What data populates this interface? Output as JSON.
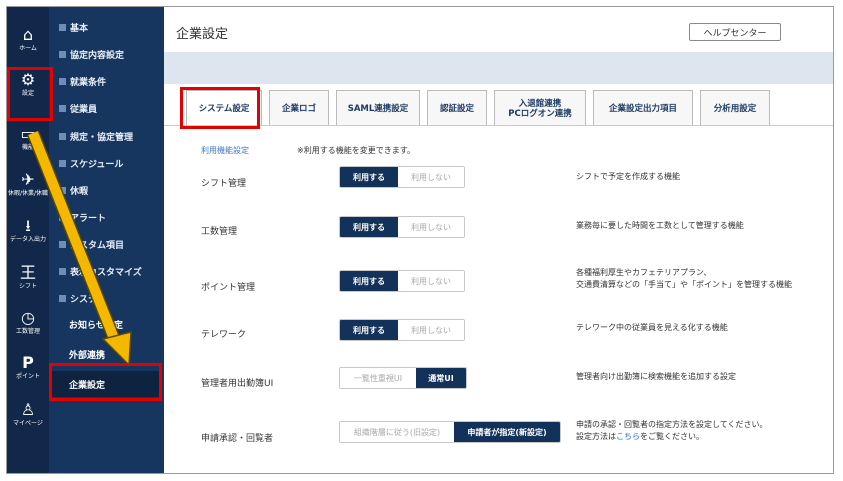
{
  "rail": [
    {
      "icon": "home-icon",
      "glyph": "⌂",
      "label": "ホーム"
    },
    {
      "icon": "gear-icon",
      "glyph": "⚙",
      "label": "設定"
    },
    {
      "icon": "function-icon",
      "glyph": "▭",
      "label": "機能"
    },
    {
      "icon": "plane-icon",
      "glyph": "✈",
      "label": "休暇/休業/休職"
    },
    {
      "icon": "download-icon",
      "glyph": "⭳",
      "label": "データ入出力"
    },
    {
      "icon": "shift-icon",
      "glyph": "王",
      "label": "シフト"
    },
    {
      "icon": "clock-icon",
      "glyph": "◷",
      "label": "工数管理"
    },
    {
      "icon": "point-icon",
      "glyph": "P",
      "label": "ポイント"
    },
    {
      "icon": "user-icon",
      "glyph": "♙",
      "label": "マイページ"
    }
  ],
  "menu": {
    "items": [
      {
        "label": "基本"
      },
      {
        "label": "協定内容設定"
      },
      {
        "label": "就業条件"
      },
      {
        "label": "従業員"
      },
      {
        "label": "規定・協定管理"
      },
      {
        "label": "スケジュール"
      },
      {
        "label": "休暇"
      },
      {
        "label": "アラート"
      },
      {
        "label": "カスタム項目"
      },
      {
        "label": "表示カスタマイズ"
      },
      {
        "label": "システム"
      }
    ],
    "sub": [
      {
        "label": "お知らせ設定"
      },
      {
        "label": "外部連携"
      },
      {
        "label": "企業設定"
      }
    ]
  },
  "header": {
    "title": "企業設定",
    "help_label": "ヘルプセンター"
  },
  "tabs": [
    {
      "label": "システム設定"
    },
    {
      "label": "企業ロゴ"
    },
    {
      "label": "SAML連携設定"
    },
    {
      "label": "認証設定"
    },
    {
      "label_line1": "入退館連携",
      "label_line2": "PCログオン連携"
    },
    {
      "label": "企業設定出力項目"
    },
    {
      "label": "分析用設定"
    }
  ],
  "section": {
    "title": "利用機能設定",
    "note": "※利用する機能を変更できます。"
  },
  "rows": [
    {
      "label": "シフト管理",
      "opt_a": "利用する",
      "opt_b": "利用しない",
      "selected": "a",
      "desc1": "シフトで予定を作成する機能",
      "desc2": ""
    },
    {
      "label": "工数管理",
      "opt_a": "利用する",
      "opt_b": "利用しない",
      "selected": "a",
      "desc1": "業務毎に要した時間を工数として管理する機能",
      "desc2": ""
    },
    {
      "label": "ポイント管理",
      "opt_a": "利用する",
      "opt_b": "利用しない",
      "selected": "a",
      "desc1": "各種福利厚生やカフェテリアプラン、",
      "desc2": "交通費清算などの「手当て」や「ポイント」を管理する機能"
    },
    {
      "label": "テレワーク",
      "opt_a": "利用する",
      "opt_b": "利用しない",
      "selected": "a",
      "desc1": "テレワーク中の従業員を見える化する機能",
      "desc2": ""
    },
    {
      "label": "管理者用出勤簿UI",
      "opt_a": "一覧性重視UI",
      "opt_b": "通常UI",
      "selected": "b",
      "desc1": "管理者向け出勤簿に検索機能を追加する設定",
      "desc2": ""
    },
    {
      "label": "申請承認・回覧者",
      "opt_a": "組織階層に従う(旧設定)",
      "opt_b": "申請者が指定(新設定)",
      "selected": "b",
      "desc1": "申請の承認・回覧者の指定方法を設定してください。",
      "desc2_pre": "設定方法は",
      "desc2_link": "こちら",
      "desc2_post": "をご覧ください。"
    }
  ],
  "colors": {
    "rail": "#12284a",
    "menu": "#16365f",
    "toggle_on": "#13325a",
    "annotation_red": "#e30000",
    "annotation_arrow": "#f5b800"
  }
}
